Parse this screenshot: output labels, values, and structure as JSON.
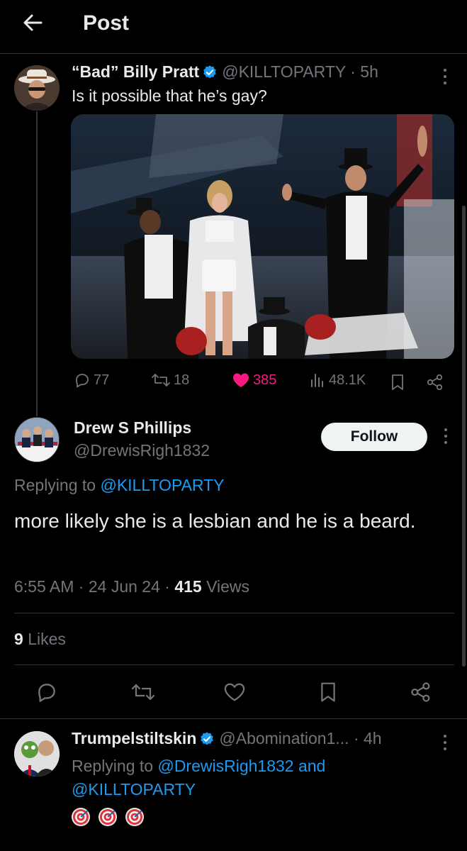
{
  "header": {
    "title": "Post"
  },
  "original_post": {
    "author_name": "“Bad” Billy Pratt",
    "handle": "@KILLTOPARTY",
    "separator": "·",
    "time": "5h",
    "text": "Is it possible that he’s gay?",
    "stats": {
      "replies": "77",
      "reposts": "18",
      "likes": "385",
      "views": "48.1K"
    },
    "colors": {
      "liked": "#f91880",
      "verified": "#1d9bf0"
    }
  },
  "reply": {
    "author_name": "Drew S Phillips",
    "handle": "@DrewisRigh1832",
    "follow_label": "Follow",
    "replying_prefix": "Replying to",
    "replying_to": "@KILLTOPARTY",
    "text": "more likely she is a lesbian and he is a beard.",
    "time": "6:55 AM",
    "date": "24 Jun 24",
    "dot": "·",
    "views_count": "415",
    "views_label": "Views",
    "likes_count": "9",
    "likes_label": "Likes"
  },
  "second_reply": {
    "author_name": "Trumpelstiltskin",
    "handle": "@Abomination1...",
    "separator": "·",
    "time": "4h",
    "replying_prefix": "Replying to",
    "replying_to_1": "@DrewisRigh1832",
    "conjunction": "and",
    "replying_to_2": "@KILLTOPARTY",
    "emoji": [
      "target-icon",
      "target-icon",
      "target-icon"
    ]
  }
}
